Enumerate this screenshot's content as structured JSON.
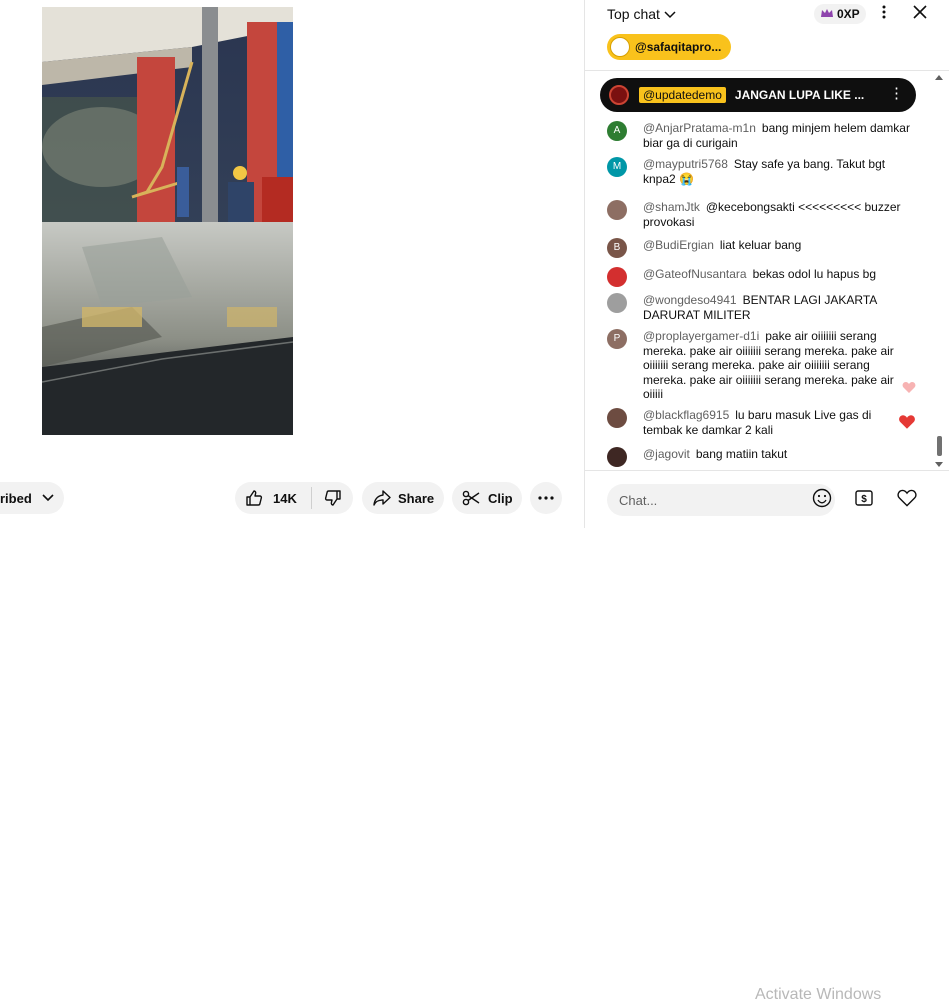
{
  "video": {
    "actions": {
      "subscribe_label": "ribed",
      "like_count": "14K",
      "share_label": "Share",
      "clip_label": "Clip"
    }
  },
  "chat": {
    "header_title": "Top chat",
    "xp_label": "0XP",
    "sticker_user": "@safaqitapro...",
    "pinned": {
      "author": "@updatedemo",
      "message": "JANGAN LUPA LIKE ..."
    },
    "messages": [
      {
        "author": "@AnjarPratama-m1n",
        "text": "bang minjem helem damkar biar ga di curigain",
        "avatar_letter": "A",
        "avatar_color": "#2e7d32"
      },
      {
        "author": "@mayputri5768",
        "text": "Stay safe ya bang. Takut bgt knpa2 😭",
        "avatar_letter": "M",
        "avatar_color": "#0097a7"
      },
      {
        "author": "@shamJtk",
        "text": "@kecebongsakti <<<<<<<<< buzzer provokasi",
        "avatar_letter": "",
        "avatar_color": "#8d6e63"
      },
      {
        "author": "@BudiErgian",
        "text": "liat keluar bang",
        "avatar_letter": "B",
        "avatar_color": "#795548"
      },
      {
        "author": "@GateofNusantara",
        "text": "bekas odol lu hapus bg",
        "avatar_letter": "",
        "avatar_color": "#d32f2f"
      },
      {
        "author": "@wongdeso4941",
        "text": "BENTAR LAGI JAKARTA DARURAT MILITER",
        "avatar_letter": "",
        "avatar_color": "#9e9e9e"
      },
      {
        "author": "@proplayergamer-d1i",
        "text": "pake air oiiiiiii serang mereka. pake air oiiiiiii serang mereka. pake air oiiiiiii serang mereka. pake air oiiiiiii serang mereka. pake air oiiiiiii serang mereka. pake air oiiiii",
        "avatar_letter": "P",
        "avatar_color": "#8d6e63"
      },
      {
        "author": "@blackflag6915",
        "text": "lu baru masuk Live gas di tembak ke damkar 2 kali",
        "avatar_letter": "",
        "avatar_color": "#6d4c41"
      },
      {
        "author": "@jagovit",
        "text": "bang matiin takut",
        "avatar_letter": "",
        "avatar_color": "#3e2723"
      }
    ],
    "input_placeholder": "Chat...",
    "watermark": "Activate Windows"
  },
  "colors": {
    "accent_yellow": "#f9c21c",
    "heart_red": "#e53935",
    "heart_pink": "#f7b3b3"
  }
}
